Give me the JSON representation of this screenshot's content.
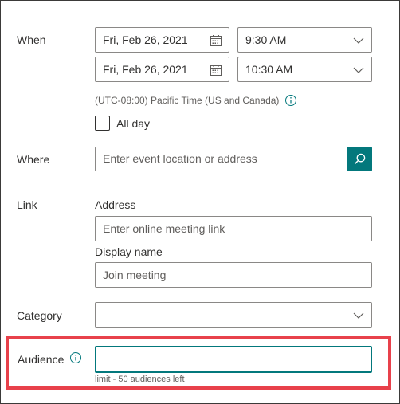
{
  "when": {
    "label": "When",
    "start_date": "Fri, Feb 26, 2021",
    "start_time": "9:30 AM",
    "end_date": "Fri, Feb 26, 2021",
    "end_time": "10:30 AM",
    "timezone": "(UTC-08:00) Pacific Time (US and Canada)",
    "all_day_label": "All day"
  },
  "where": {
    "label": "Where",
    "placeholder": "Enter event location or address"
  },
  "link": {
    "label": "Link",
    "address_label": "Address",
    "address_placeholder": "Enter online meeting link",
    "display_name_label": "Display name",
    "display_name_placeholder": "Join meeting"
  },
  "category": {
    "label": "Category",
    "value": ""
  },
  "audience": {
    "label": "Audience",
    "value": "",
    "hint": "limit - 50 audiences left"
  },
  "colors": {
    "accent": "#03787c",
    "highlight": "#e8414b",
    "text": "#323130",
    "secondary_text": "#605e5c"
  },
  "icons": [
    "calendar-icon",
    "chevron-down-icon",
    "info-icon",
    "search-icon"
  ]
}
